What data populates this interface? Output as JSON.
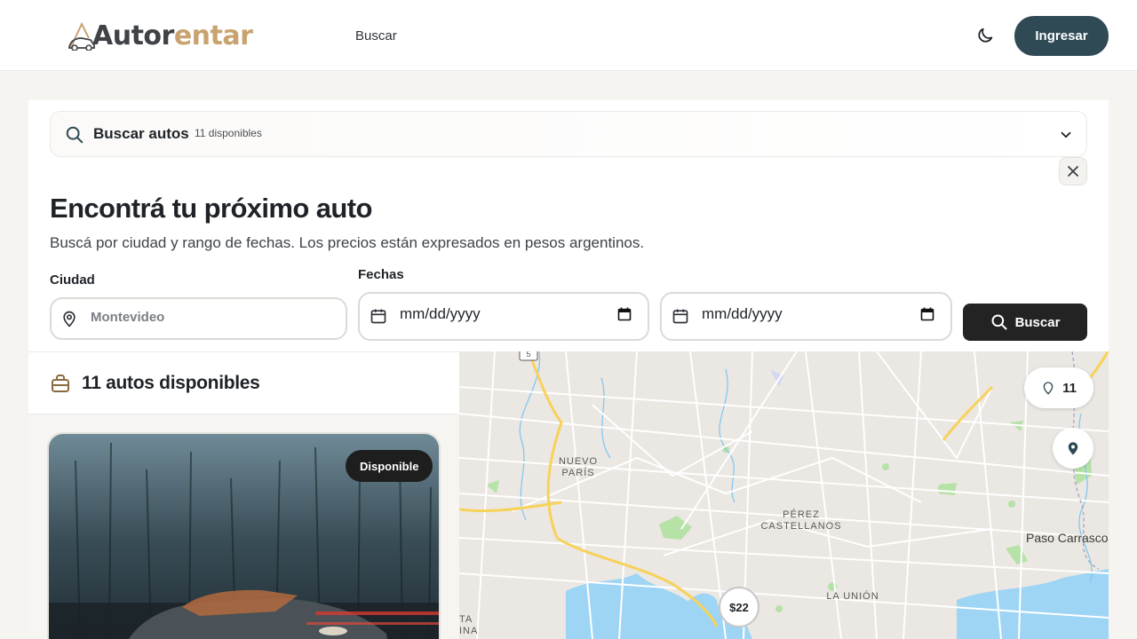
{
  "header": {
    "logo_part1": "Autor",
    "logo_part2": "entar",
    "nav_search": "Buscar",
    "login_label": "Ingresar"
  },
  "searchbar": {
    "title": "Buscar autos",
    "count": "11 disponibles"
  },
  "hero": {
    "title": "Encontrá tu próximo auto",
    "subtitle": "Buscá por ciudad y rango de fechas. Los precios están expresados en pesos argentinos."
  },
  "form": {
    "city_label": "Ciudad",
    "city_placeholder": "Montevideo",
    "dates_label": "Fechas",
    "date_start": "mm/dd/yyyy",
    "date_end": "mm/dd/yyyy",
    "submit_label": "Buscar"
  },
  "results": {
    "title": "11 autos disponibles",
    "card_badge": "Disponible"
  },
  "map": {
    "count": "11",
    "price_marker": "$22",
    "labels": {
      "nuevo_paris": "NUEVO\nPARÍS",
      "perez": "PÉREZ\nCASTELLANOS",
      "la_union": "LA UNIÓN",
      "paso": "Paso Carrasco",
      "route": "5",
      "edge": "TA\nINA"
    }
  },
  "colors": {
    "brand_dark": "#2f4a55",
    "brand_gold": "#c9a36f",
    "background": "#f5f4f0"
  }
}
